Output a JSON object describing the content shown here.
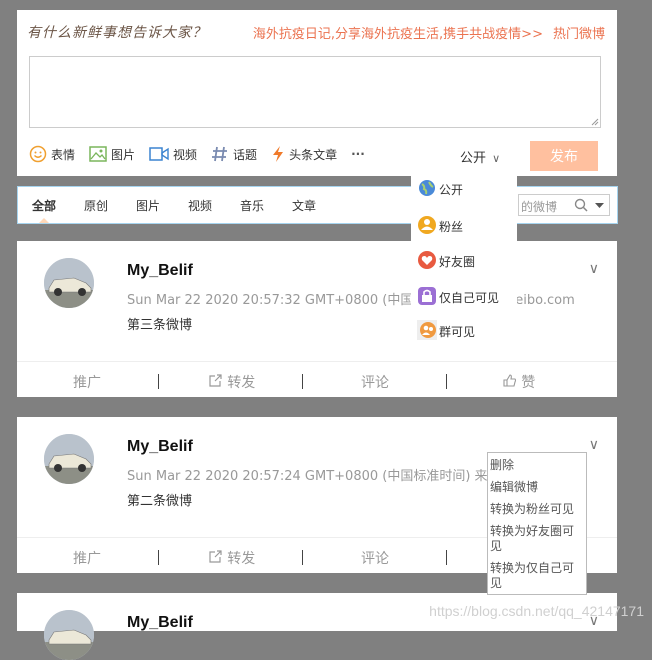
{
  "composer": {
    "prompt": "有什么新鲜事想告诉大家？",
    "hot_topic": "海外抗疫日记,分享海外抗疫生活,携手共战疫情>>",
    "hot_weibo": "热门微博",
    "toolbar": [
      {
        "label": "表情",
        "icon": "smile-icon"
      },
      {
        "label": "图片",
        "icon": "image-icon"
      },
      {
        "label": "视频",
        "icon": "video-icon"
      },
      {
        "label": "话题",
        "icon": "hashtag-icon"
      },
      {
        "label": "头条文章",
        "icon": "lightning-icon"
      }
    ],
    "more": "···",
    "visibility": "公开",
    "visibility_arrow": "∨",
    "publish": "发布"
  },
  "tabs": [
    "全部",
    "原创",
    "图片",
    "视频",
    "音乐",
    "文章"
  ],
  "search": {
    "text": "的微博"
  },
  "visibility_menu": [
    {
      "label": "公开",
      "icon": "globe-icon"
    },
    {
      "label": "粉丝",
      "icon": "fans-icon"
    },
    {
      "label": "好友圈",
      "icon": "heart-icon"
    },
    {
      "label": "仅自己可见",
      "icon": "lock-icon"
    },
    {
      "label": "群可见",
      "icon": "group-icon"
    }
  ],
  "posts": [
    {
      "nickname": "My_Belif",
      "time": "Sun Mar 22 2020 20:57:32 GMT+0800 (中国标准时间) 来自 weibo.com",
      "content": "第三条微博"
    },
    {
      "nickname": "My_Belif",
      "time": "Sun Mar 22 2020 20:57:24 GMT+0800 (中国标准时间) 来自",
      "content": "第二条微博"
    },
    {
      "nickname": "My_Belif"
    }
  ],
  "post_actions": {
    "promote": "推广",
    "repost": "转发",
    "comment": "评论",
    "like": "赞"
  },
  "manage_menu": [
    "删除",
    "编辑微博",
    "转换为粉丝可见",
    "转换为好友圈可见",
    "转换为仅自己可见"
  ],
  "watermark": "https://blog.csdn.net/qq_42147171",
  "colors": {
    "accent": "#eb7350",
    "publish_bg": "#ffc09f",
    "background": "#808080",
    "tab_border": "#a6d4ef"
  }
}
